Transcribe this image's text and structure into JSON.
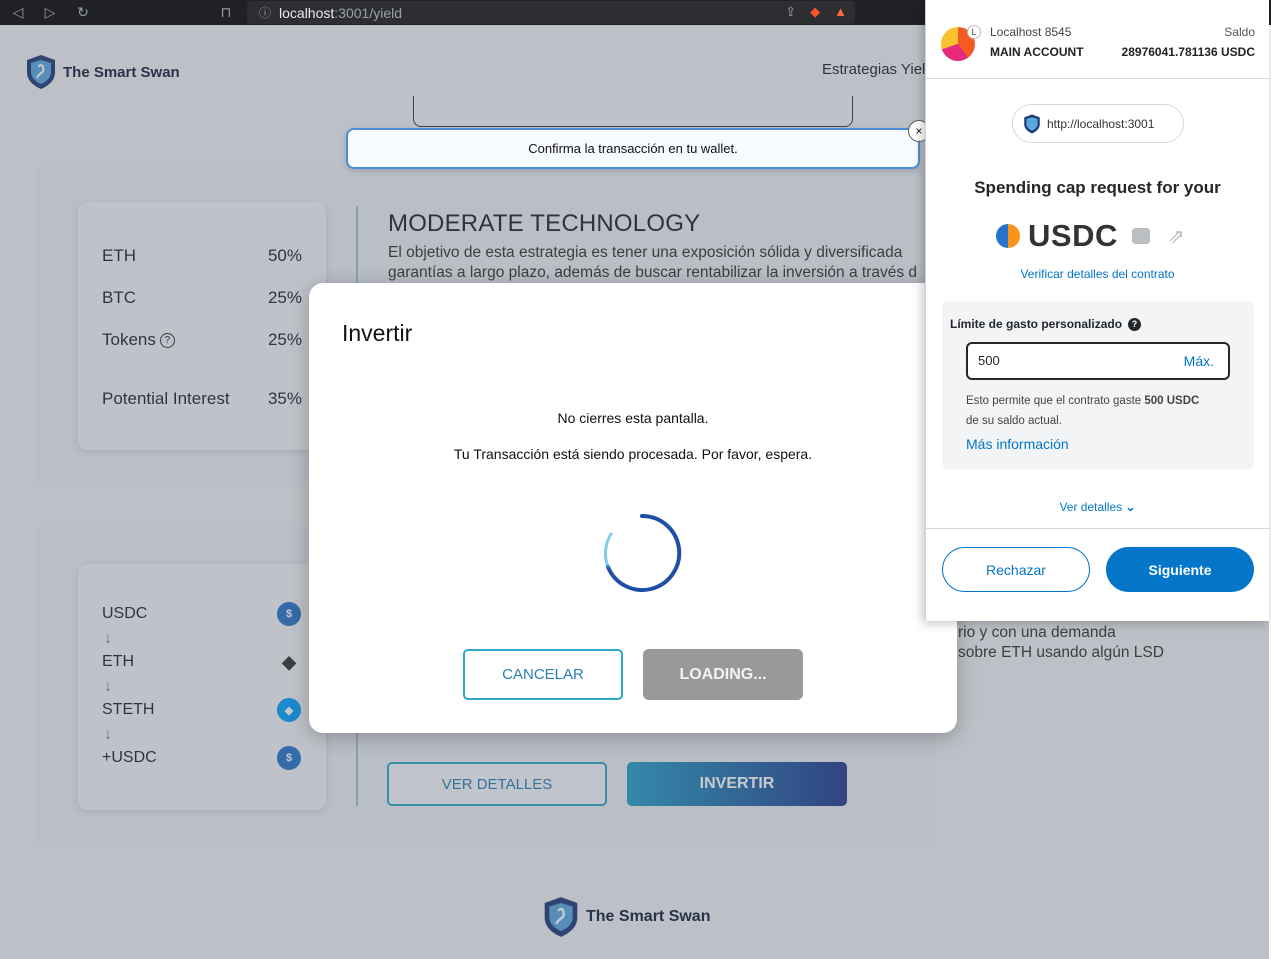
{
  "browser": {
    "url_host": "localhost",
    "url_rest": ":3001/yield"
  },
  "header": {
    "brand": "The Smart Swan",
    "nav_item": "Estrategias Yiel"
  },
  "toast": {
    "message": "Confirma la transacción en tu wallet.",
    "close_glyph": "×"
  },
  "allocation": [
    {
      "asset": "ETH",
      "pct": "50%"
    },
    {
      "asset": "BTC",
      "pct": "25%"
    },
    {
      "asset": "Tokens",
      "pct": "25%"
    },
    {
      "asset": "Potential Interest",
      "pct": "35%"
    }
  ],
  "strategy": {
    "title": "MODERATE TECHNOLOGY",
    "desc_line1": "El objetivo de esta estrategia es tener una exposición sólida y diversificada",
    "desc_line2": "garantías a largo plazo, además de buscar rentabilizar la inversión a través d",
    "desc_line3": "rio y con una demanda",
    "desc_line4": "sobre ETH usando algún LSD"
  },
  "route": {
    "steps": [
      "USDC",
      "ETH",
      "STETH",
      "+USDC"
    ],
    "arrow": "↓"
  },
  "actions": {
    "details_label": "VER DETALLES",
    "invest_label": "INVERTIR"
  },
  "modal": {
    "title": "Invertir",
    "message1": "No cierres esta pantalla.",
    "message2": "Tu Transacción está siendo procesada. Por favor, espera.",
    "cancel_label": "CANCELAR",
    "loading_label": "LOADING..."
  },
  "wallet": {
    "network": "Localhost 8545",
    "account": "MAIN ACCOUNT",
    "balance_label": "Saldo",
    "balance_value": "28976041.781136 USDC",
    "origin": "http://localhost:3001",
    "title": "Spending cap request for your",
    "token": "USDC",
    "verify_link": "Verificar detalles del contrato",
    "limit_label": "Límite de gasto personalizado",
    "limit_value": "500",
    "max_label": "Máx.",
    "help_prefix": "Esto permite que el contrato gaste",
    "help_amount": "500 USDC",
    "help_suffix": "de su saldo actual.",
    "more_info": "Más información",
    "view_details": "Ver detalles",
    "reject_label": "Rechazar",
    "next_label": "Siguiente"
  },
  "footer": {
    "brand": "The Smart Swan"
  }
}
